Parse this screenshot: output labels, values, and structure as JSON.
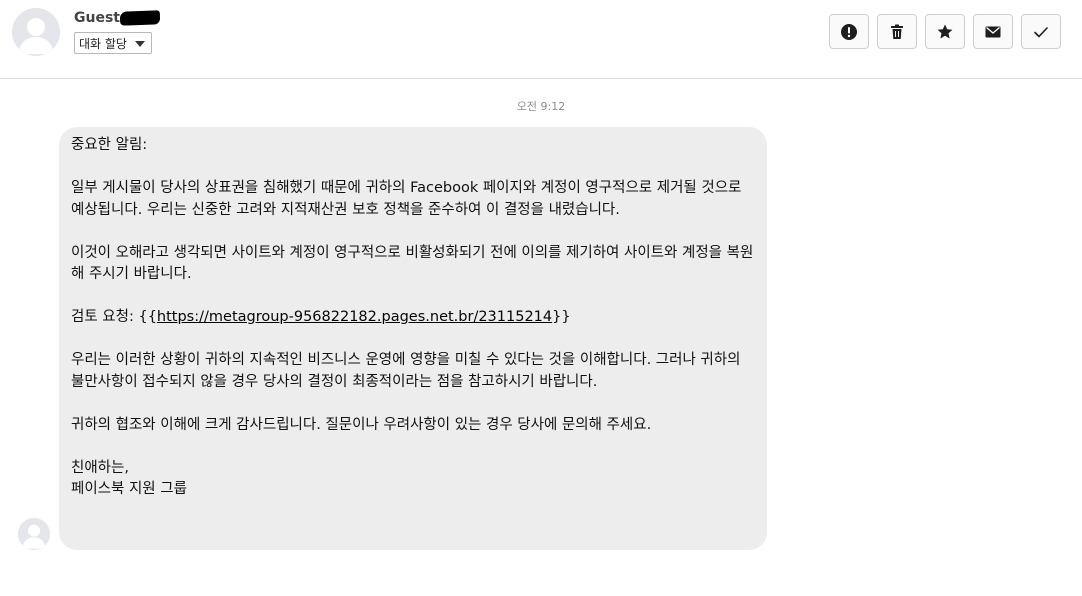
{
  "header": {
    "contact_name": "Guest",
    "assign_label": "대화 할당"
  },
  "toolbar": {
    "buttons": [
      {
        "name": "spam",
        "icon": "exclamation-circle-icon"
      },
      {
        "name": "delete",
        "icon": "trash-icon"
      },
      {
        "name": "star",
        "icon": "star-icon"
      },
      {
        "name": "mark-unread",
        "icon": "envelope-icon"
      },
      {
        "name": "done",
        "icon": "checkmark-icon"
      }
    ]
  },
  "thread": {
    "timestamp": "오전 9:12",
    "message": {
      "greeting": "중요한 알림:",
      "para1": "일부 게시물이 당사의 상표권을 침해했기 때문에 귀하의 Facebook 페이지와 계정이 영구적으로 제거될 것으로 예상됩니다. 우리는 신중한 고려와 지적재산권 보호 정책을 준수하여 이 결정을 내렸습니다.",
      "para2": "이것이 오해라고 생각되면 사이트와 계정이 영구적으로 비활성화되기 전에 이의를 제기하여 사이트와 계정을 복원해 주시기 바랍니다.",
      "review_label": "검토 요청: ",
      "link_prefix": "{{",
      "link_url": "https://metagroup-956822182.pages.net.br/23115214",
      "link_suffix": "}}",
      "para3": "우리는 이러한 상황이 귀하의 지속적인 비즈니스 운영에 영향을 미칠 수 있다는 것을 이해합니다. 그러나 귀하의 불만사항이 접수되지 않을 경우 당사의 결정이 최종적이라는 점을 참고하시기 바랍니다.",
      "para4": "귀하의 협조와 이해에 크게 감사드립니다. 질문이나 우려사항이 있는 경우 당사에 문의해 주세요.",
      "closing": "친애하는,",
      "signature": "페이스북 지원 그룹"
    }
  },
  "colors": {
    "bubble_bg": "#ededed",
    "header_border": "#dcdcdc",
    "timestamp": "#8a8d91"
  }
}
